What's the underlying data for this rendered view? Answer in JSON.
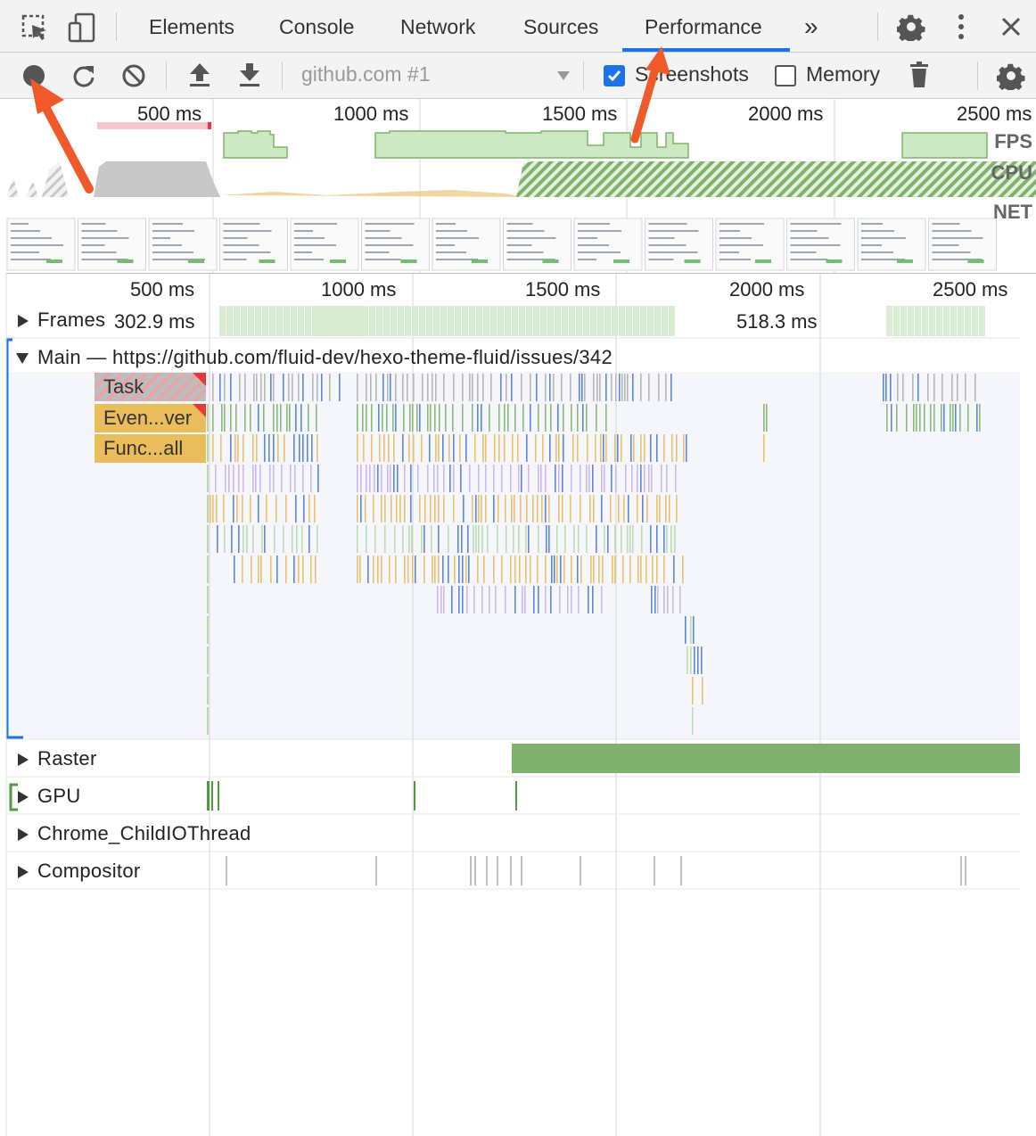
{
  "tabs": {
    "elements": "Elements",
    "console": "Console",
    "network": "Network",
    "sources": "Sources",
    "performance": "Performance",
    "more": "»"
  },
  "toolbar": {
    "profile_select": "github.com #1",
    "screenshots_label": "Screenshots",
    "screenshots_checked": true,
    "memory_label": "Memory",
    "memory_checked": false
  },
  "overview": {
    "ticks": [
      "500 ms",
      "1000 ms",
      "1500 ms",
      "2000 ms",
      "2500 ms"
    ],
    "lanes": [
      "FPS",
      "CPU",
      "NET"
    ]
  },
  "timeline": {
    "ticks": [
      "500 ms",
      "1000 ms",
      "1500 ms",
      "2000 ms",
      "2500 ms"
    ]
  },
  "tracks": {
    "frames_label": "Frames",
    "frames_time_1": "302.9 ms",
    "frames_time_2": "518.3 ms",
    "main_label": "Main — https://github.com/fluid-dev/hexo-theme-fluid/issues/342",
    "task_label": "Task",
    "event_label": "Even...ver",
    "func_label": "Func...all",
    "raster_label": "Raster",
    "gpu_label": "GPU",
    "childio_label": "Chrome_ChildIOThread",
    "compositor_label": "Compositor"
  },
  "colors": {
    "accent": "#1a73e8",
    "fps_green": "#cde9c4",
    "cpu_green": "#7fb26b",
    "task_gray": "#bdbdbd",
    "event_yellow": "#e9bd5b",
    "raster_green": "#81b16e",
    "annotation_red": "#f05a2a"
  }
}
